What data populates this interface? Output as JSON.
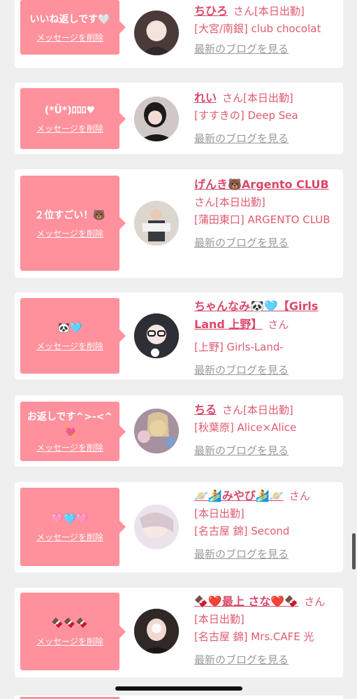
{
  "delete_label": "メッセージを削除",
  "blog_label": "最新のブログを見る",
  "san": "さん",
  "items": [
    {
      "message": "いいね返しです🤍",
      "name": "ちひろ",
      "status": "[本日出勤]",
      "shop": "[大宮/南銀] club chocolat"
    },
    {
      "message": "(*Ü*)ﾛﾛﾛ♥",
      "name": "れい",
      "status": "[本日出勤]",
      "shop": "[すすきの] Deep Sea"
    },
    {
      "message": "２位すごい！🐻",
      "name": "げんき🐻Argento CLUB",
      "status": "[本日出勤]",
      "shop": "[蒲田東口] ARGENTO CLUB"
    },
    {
      "message": "🐼🩵",
      "name": "ちゃんなみ🐼🩵【Girls Land 上野】",
      "status": "",
      "shop": "[上野] Girls-Land-"
    },
    {
      "message": "お返しです^>-<^💘",
      "name": "ちる",
      "status": "[本日出勤]",
      "shop": "[秋葉原] Alice×Alice"
    },
    {
      "message": "🩷🩵🩷",
      "name": "🪐🏄みやび🏄🪐",
      "status": "[本日出勤]",
      "shop": "[名古屋 錦] Second"
    },
    {
      "message": "🍫🍫🍫",
      "name": "🍫❤️最上 さな❤️🍫",
      "status": "[本日出勤]",
      "shop": "[名古屋 錦] Mrs.CAFE 光"
    }
  ],
  "colors": {
    "bubble": "#ff919c",
    "name": "#d9486a",
    "text": "#e05a70",
    "link_gray": "#9a9a9a"
  }
}
